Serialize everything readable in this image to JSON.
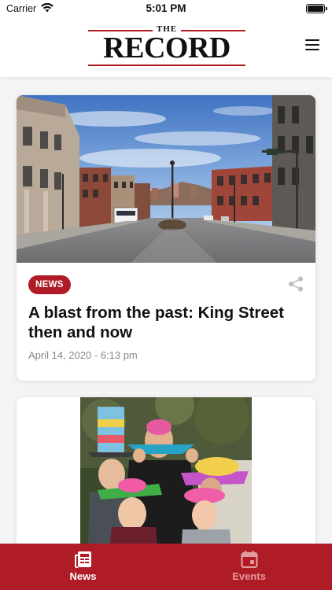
{
  "status_bar": {
    "carrier": "Carrier",
    "time": "5:01 PM"
  },
  "header": {
    "logo_small": "THE",
    "logo_main": "RECORD"
  },
  "articles": [
    {
      "category": "NEWS",
      "title": "A blast from the past: King Street then and now",
      "date": "April 14, 2020 - 6:13 pm"
    }
  ],
  "tabs": [
    {
      "label": "News",
      "active": true
    },
    {
      "label": "Events",
      "active": false
    }
  ],
  "colors": {
    "accent": "#b01c26",
    "inactive_tab_text": "#e39aa0"
  },
  "icons": [
    "wifi-icon",
    "battery-icon",
    "menu-icon",
    "share-icon",
    "newspaper-icon",
    "calendar-icon"
  ]
}
